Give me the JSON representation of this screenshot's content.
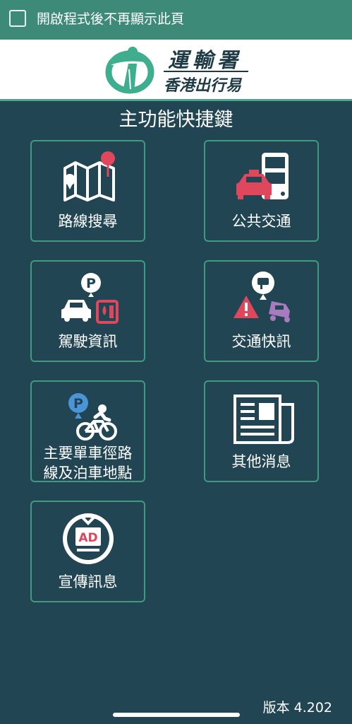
{
  "top_bar": {
    "checkbox_label": "開啟程式後不再顯示此頁"
  },
  "header": {
    "title": "運輸署",
    "subtitle": "香港出行易"
  },
  "section_title": "主功能快捷鍵",
  "tiles": [
    {
      "label": "路線搜尋",
      "icon": "map-pin-icon"
    },
    {
      "label": "公共交通",
      "icon": "bus-taxi-icon"
    },
    {
      "label": "駕駛資訊",
      "icon": "car-parking-fuel-icon"
    },
    {
      "label": "交通快訊",
      "icon": "traffic-alert-icon"
    },
    {
      "label_line1": "主要單車徑路",
      "label_line2": "線及泊車地點",
      "icon": "bicycle-parking-icon"
    },
    {
      "label": "其他消息",
      "icon": "newspaper-icon"
    },
    {
      "label": "宣傳訊息",
      "icon": "tv-ad-icon"
    }
  ],
  "version": "版本 4.202",
  "colors": {
    "background": "#224553",
    "top_bar": "#3d8a79",
    "tile_border": "#3c9b80",
    "accent_red": "#e0475c"
  }
}
